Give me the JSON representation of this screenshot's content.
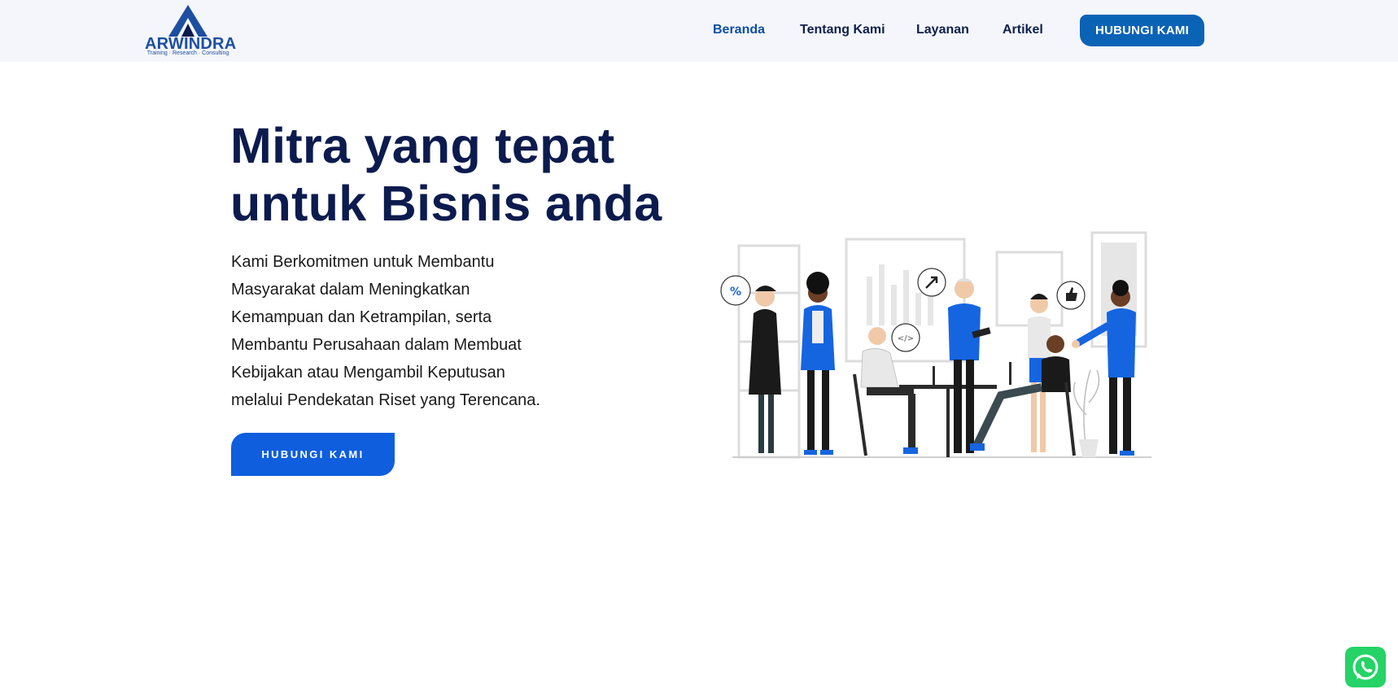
{
  "header": {
    "logo": {
      "name": "ARWINDRA",
      "tagline": "Training · Research · Consulting"
    },
    "nav": [
      {
        "label": "Beranda",
        "active": true
      },
      {
        "label": "Tentang Kami",
        "active": false
      },
      {
        "label": "Layanan",
        "active": false
      },
      {
        "label": "Artikel",
        "active": false
      }
    ],
    "cta_label": "HUBUNGI KAMI"
  },
  "hero": {
    "title_line1": "Mitra yang tepat",
    "title_line2": "untuk Bisnis anda",
    "description": "Kami Berkomitmen untuk Membantu Masyarakat dalam Meningkatkan Kemampuan dan Ketrampilan, serta Membantu Perusahaan dalam Membuat Kebijakan atau Mengambil Keputusan melalui Pendekatan Riset yang Terencana.",
    "cta_label": "HUBUNGI KAMI"
  },
  "illustration": {
    "bubble_percent": "%",
    "bubble_code": "</>"
  },
  "colors": {
    "brand_blue": "#0b63b6",
    "cta_blue": "#0e5ede",
    "title_navy": "#0c1b4e",
    "accent_blue": "#1565e0"
  },
  "icons": {
    "whatsapp": "whatsapp-icon"
  }
}
